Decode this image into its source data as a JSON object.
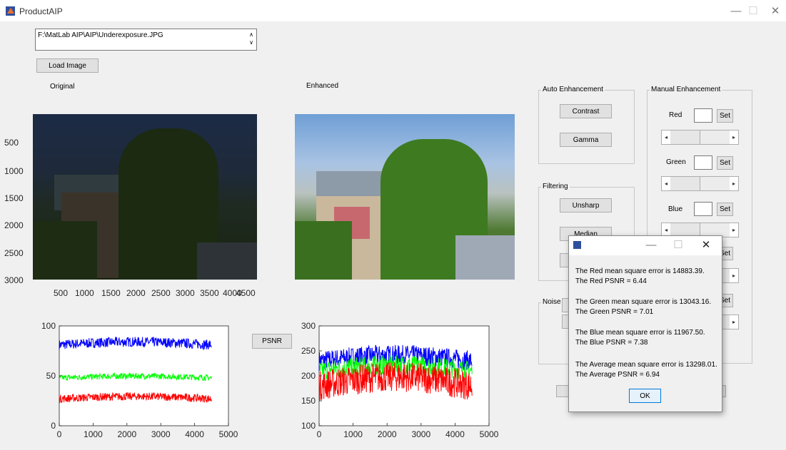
{
  "window": {
    "title": "ProductAIP",
    "controls": [
      "—",
      "☐",
      "✕"
    ]
  },
  "file": {
    "path": "F:\\MatLab AIP\\AIP\\Underexposure.JPG"
  },
  "buttons": {
    "load_image": "Load Image",
    "psnr": "PSNR",
    "contrast": "Contrast",
    "gamma": "Gamma",
    "unsharp": "Unsharp",
    "median": "Median",
    "set": "Set"
  },
  "labels": {
    "original": "Original",
    "enhanced": "Enhanced"
  },
  "panels": {
    "auto": "Auto Enhancement",
    "manual": "Manual Enhancement",
    "filtering": "Filtering",
    "noise": "Noise"
  },
  "manual": {
    "red": "Red",
    "green": "Green",
    "blue": "Blue"
  },
  "image_axes": {
    "y_ticks": [
      "500",
      "1000",
      "1500",
      "2000",
      "2500",
      "3000"
    ],
    "x_ticks": [
      "500",
      "1000",
      "1500",
      "2000",
      "2500",
      "3000",
      "3500",
      "4000",
      "4500"
    ]
  },
  "chart_data": [
    {
      "type": "line",
      "x_ticks": [
        "0",
        "1000",
        "2000",
        "3000",
        "4000",
        "5000"
      ],
      "y_ticks": [
        "0",
        "50",
        "100"
      ],
      "xlim": [
        0,
        5000
      ],
      "ylim": [
        0,
        100
      ],
      "series": [
        {
          "color": "#0000ff",
          "mean": 81,
          "noise": 5
        },
        {
          "color": "#00ff00",
          "mean": 48,
          "noise": 3
        },
        {
          "color": "#ff0000",
          "mean": 27,
          "noise": 4
        }
      ]
    },
    {
      "type": "line",
      "x_ticks": [
        "0",
        "1000",
        "2000",
        "3000",
        "4000",
        "5000"
      ],
      "y_ticks": [
        "100",
        "150",
        "200",
        "250",
        "300"
      ],
      "xlim": [
        0,
        5000
      ],
      "ylim": [
        100,
        300
      ],
      "series": [
        {
          "color": "#0000ff",
          "mean": 230,
          "noise": 20
        },
        {
          "color": "#00ff00",
          "mean": 210,
          "noise": 20
        },
        {
          "color": "#ff0000",
          "mean": 180,
          "noise": 30
        }
      ]
    }
  ],
  "dialog": {
    "controls": [
      "—",
      "☐",
      "✕"
    ],
    "red_mse": "The Red mean square error is 14883.39.",
    "red_psnr": "The Red PSNR = 6.44",
    "green_mse": "The Green mean square error is 13043.16.",
    "green_psnr": "The Green PSNR = 7.01",
    "blue_mse": "The Blue mean square error is 11967.50.",
    "blue_psnr": "The Blue PSNR = 7.38",
    "avg_mse": "The Average mean square error is 13298.01.",
    "avg_psnr": "The Average PSNR = 6.94",
    "ok": "OK"
  }
}
